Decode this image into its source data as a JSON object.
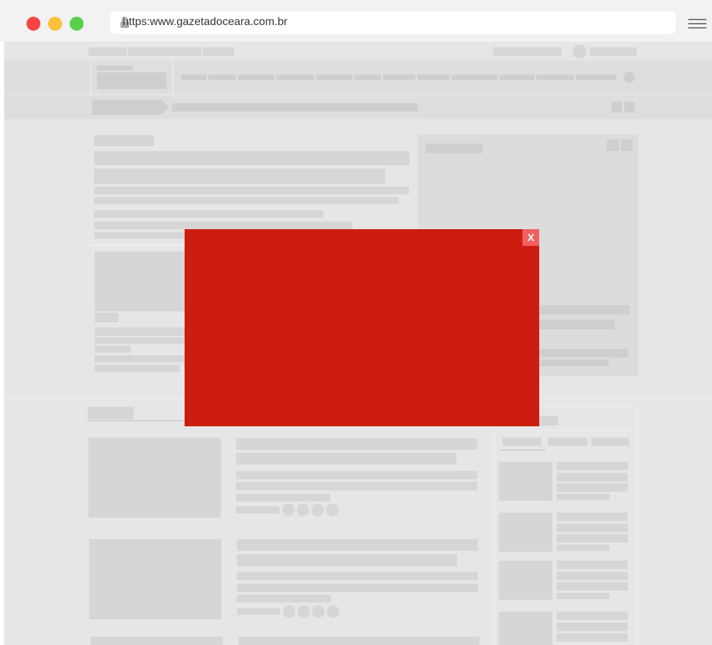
{
  "browser": {
    "url": "https:www.gazetadoceara.com.br",
    "traffic_lights": [
      "#fd4444",
      "#fec13a",
      "#58d04b"
    ],
    "menu_icon": "hamburger-icon",
    "lock_icon": "lock-icon"
  },
  "modal": {
    "close_label": "X",
    "background": "#cc1d10",
    "close_background": "#f06060"
  }
}
